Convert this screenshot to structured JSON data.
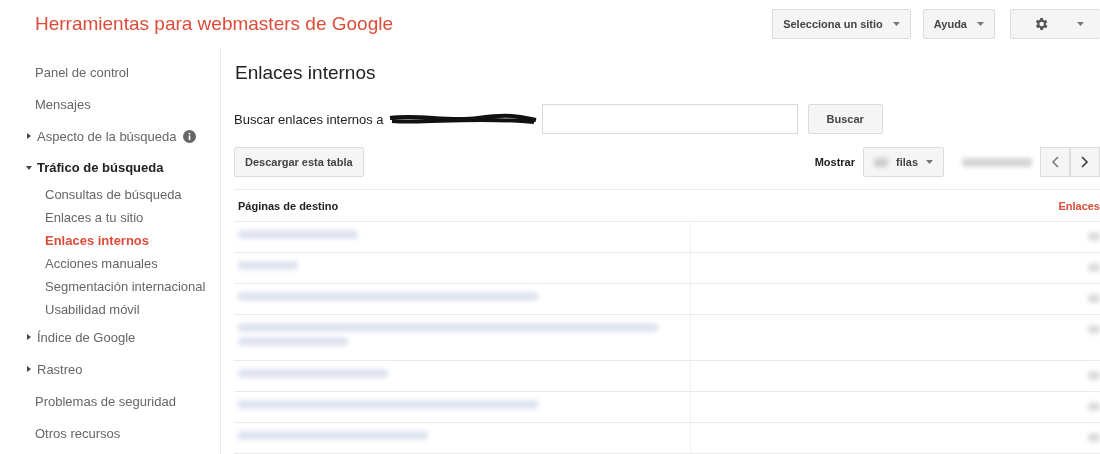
{
  "header": {
    "title": "Herramientas para webmasters de Google",
    "site_menu": "Selecciona un sitio",
    "help_menu": "Ayuda"
  },
  "sidebar": {
    "items": [
      {
        "label": "Panel de control",
        "kind": "link"
      },
      {
        "label": "Mensajes",
        "kind": "link"
      },
      {
        "label": "Aspecto de la búsqueda",
        "kind": "section",
        "expanded": false,
        "info": true
      },
      {
        "label": "Tráfico de búsqueda",
        "kind": "section",
        "expanded": true,
        "children": [
          {
            "label": "Consultas de búsqueda",
            "selected": false
          },
          {
            "label": "Enlaces a tu sitio",
            "selected": false
          },
          {
            "label": "Enlaces internos",
            "selected": true
          },
          {
            "label": "Acciones manuales",
            "selected": false
          },
          {
            "label": "Segmentación internacional",
            "selected": false
          },
          {
            "label": "Usabilidad móvil",
            "selected": false
          }
        ]
      },
      {
        "label": "Índice de Google",
        "kind": "section",
        "expanded": false
      },
      {
        "label": "Rastreo",
        "kind": "section",
        "expanded": false
      },
      {
        "label": "Problemas de seguridad",
        "kind": "link"
      },
      {
        "label": "Otros recursos",
        "kind": "link"
      }
    ]
  },
  "main": {
    "title": "Enlaces internos",
    "search_label": "Buscar enlaces internos a",
    "search_button": "Buscar",
    "download_button": "Descargar esta tabla",
    "show_label": "Mostrar",
    "rows_unit": "filas",
    "table": {
      "columns": [
        "Páginas de destino",
        "Enlaces"
      ],
      "rows": [
        {
          "kind": "blurred"
        },
        {
          "kind": "blurred"
        },
        {
          "kind": "blurred"
        },
        {
          "kind": "blurred-wrapped"
        },
        {
          "kind": "blurred"
        },
        {
          "kind": "blurred"
        },
        {
          "kind": "blurred"
        }
      ]
    }
  }
}
